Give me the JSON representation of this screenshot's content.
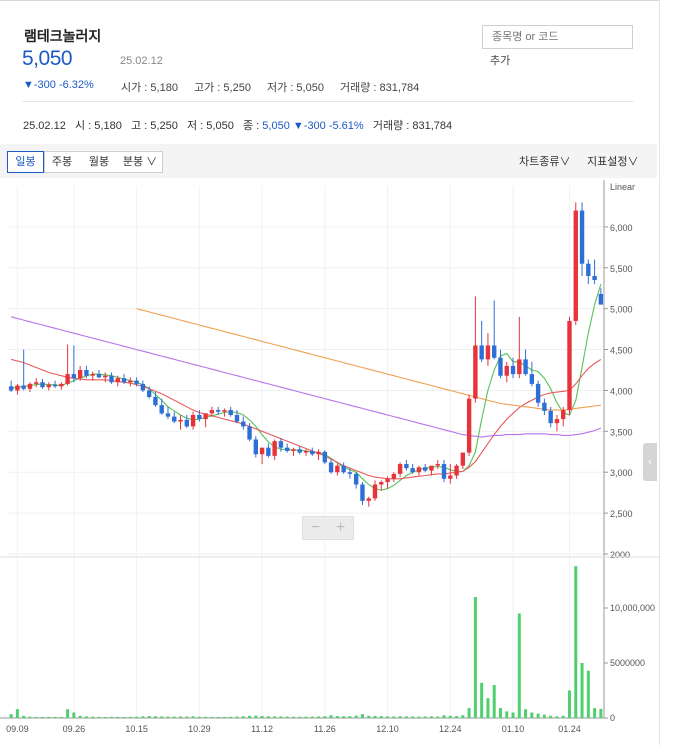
{
  "stock": {
    "name": "램테크놀러지",
    "price": "5,050",
    "date": "25.02.12",
    "change": "▼-300 -6.32%",
    "stats": [
      {
        "label": "시가 : ",
        "value": "5,180"
      },
      {
        "label": "고가 : ",
        "value": "5,250"
      },
      {
        "label": "저가 : ",
        "value": "5,050"
      },
      {
        "label": "거래량 : ",
        "value": "831,784"
      }
    ]
  },
  "search": {
    "placeholder": "종목명 or 코드",
    "add_label": "추가"
  },
  "info": {
    "date": "25.02.12",
    "open": "시 : 5,180",
    "high": "고 : 5,250",
    "low": "저 : 5,050",
    "close_label": "종 : ",
    "close": "5,050",
    "change": "▼-300 -5.61%",
    "volume": "거래량 : 831,784"
  },
  "tabs": {
    "daily": "일봉",
    "weekly": "주봉",
    "monthly": "월봉",
    "minute": "분봉 ∨"
  },
  "menus": {
    "chart_type": "차트종류∨",
    "indicator": "지표설정∨"
  },
  "zoom": {
    "minus": "−",
    "plus": "+"
  },
  "side_tab": "‹",
  "colors": {
    "up": "#e8333a",
    "down": "#2d6fd6",
    "ma5": "#58c15a",
    "ma20": "#e85a5a",
    "ma60": "#b774e8",
    "ma120": "#f0a050",
    "volume": "#4fcf6e"
  },
  "chart_data": {
    "type": "candlestick",
    "scale_label": "Linear",
    "y_ticks": [
      2000,
      2500,
      3000,
      3500,
      4000,
      4500,
      5000,
      5500,
      6000
    ],
    "y_tick_labels": [
      "2000",
      "2,500",
      "3,000",
      "3,500",
      "4,000",
      "4,500",
      "5,000",
      "5,500",
      "6,000"
    ],
    "ylim": [
      2000,
      6500
    ],
    "volume_ticks": [
      0,
      5000000,
      10000000
    ],
    "volume_tick_labels": [
      "0",
      "5000000",
      "10,000,000"
    ],
    "volume_ylim": [
      0,
      14000000
    ],
    "x_tick_labels": [
      {
        "index": 1,
        "label": "09.09"
      },
      {
        "index": 10,
        "label": "09.26"
      },
      {
        "index": 20,
        "label": "10.15"
      },
      {
        "index": 30,
        "label": "10.29"
      },
      {
        "index": 40,
        "label": "11.12"
      },
      {
        "index": 50,
        "label": "11.26"
      },
      {
        "index": 60,
        "label": "12.10"
      },
      {
        "index": 70,
        "label": "12.24"
      },
      {
        "index": 80,
        "label": "01.10"
      },
      {
        "index": 89,
        "label": "01.24"
      }
    ],
    "candles": [
      [
        4050,
        4120,
        3980,
        4000
      ],
      [
        4000,
        4080,
        3950,
        4060
      ],
      [
        4060,
        4500,
        4000,
        4020
      ],
      [
        4020,
        4100,
        3980,
        4080
      ],
      [
        4080,
        4150,
        4040,
        4100
      ],
      [
        4100,
        4140,
        4020,
        4040
      ],
      [
        4040,
        4100,
        4000,
        4070
      ],
      [
        4070,
        4120,
        4030,
        4050
      ],
      [
        4050,
        4100,
        4010,
        4080
      ],
      [
        4080,
        4560,
        4060,
        4200
      ],
      [
        4200,
        4550,
        4100,
        4150
      ],
      [
        4150,
        4300,
        4120,
        4250
      ],
      [
        4250,
        4300,
        4150,
        4180
      ],
      [
        4180,
        4230,
        4120,
        4200
      ],
      [
        4200,
        4250,
        4150,
        4160
      ],
      [
        4160,
        4220,
        4100,
        4180
      ],
      [
        4180,
        4220,
        4080,
        4100
      ],
      [
        4100,
        4180,
        4050,
        4150
      ],
      [
        4150,
        4200,
        4080,
        4100
      ],
      [
        4100,
        4160,
        4050,
        4120
      ],
      [
        4120,
        4160,
        4050,
        4080
      ],
      [
        4080,
        4120,
        3980,
        4000
      ],
      [
        4000,
        4050,
        3900,
        3920
      ],
      [
        3920,
        3980,
        3800,
        3820
      ],
      [
        3820,
        3900,
        3700,
        3720
      ],
      [
        3720,
        3800,
        3650,
        3680
      ],
      [
        3680,
        3740,
        3600,
        3620
      ],
      [
        3620,
        3700,
        3520,
        3640
      ],
      [
        3640,
        3700,
        3540,
        3560
      ],
      [
        3560,
        3740,
        3520,
        3700
      ],
      [
        3700,
        3760,
        3620,
        3650
      ],
      [
        3650,
        3720,
        3550,
        3720
      ],
      [
        3720,
        3800,
        3680,
        3760
      ],
      [
        3760,
        3800,
        3700,
        3740
      ],
      [
        3740,
        3780,
        3680,
        3760
      ],
      [
        3760,
        3800,
        3680,
        3700
      ],
      [
        3700,
        3760,
        3600,
        3620
      ],
      [
        3620,
        3680,
        3520,
        3560
      ],
      [
        3560,
        3600,
        3380,
        3400
      ],
      [
        3400,
        3440,
        3180,
        3220
      ],
      [
        3220,
        3300,
        3100,
        3300
      ],
      [
        3300,
        3350,
        3180,
        3200
      ],
      [
        3200,
        3400,
        3150,
        3380
      ],
      [
        3380,
        3420,
        3250,
        3300
      ],
      [
        3300,
        3350,
        3240,
        3260
      ],
      [
        3260,
        3300,
        3200,
        3280
      ],
      [
        3280,
        3320,
        3220,
        3240
      ],
      [
        3240,
        3280,
        3200,
        3260
      ],
      [
        3260,
        3300,
        3200,
        3220
      ],
      [
        3220,
        3280,
        3150,
        3250
      ],
      [
        3250,
        3270,
        3100,
        3120
      ],
      [
        3120,
        3160,
        2980,
        3000
      ],
      [
        3000,
        3100,
        2960,
        3080
      ],
      [
        3080,
        3120,
        2980,
        3000
      ],
      [
        3000,
        3050,
        2920,
        2980
      ],
      [
        2980,
        3000,
        2800,
        2850
      ],
      [
        2850,
        2880,
        2600,
        2650
      ],
      [
        2650,
        2700,
        2580,
        2680
      ],
      [
        2680,
        2900,
        2650,
        2850
      ],
      [
        2850,
        2900,
        2780,
        2880
      ],
      [
        2880,
        2950,
        2800,
        2920
      ],
      [
        2920,
        3000,
        2880,
        2980
      ],
      [
        2980,
        3120,
        2940,
        3100
      ],
      [
        3100,
        3150,
        3020,
        3050
      ],
      [
        3050,
        3100,
        2980,
        3000
      ],
      [
        3000,
        3080,
        2960,
        3060
      ],
      [
        3060,
        3100,
        3000,
        3020
      ],
      [
        3020,
        3060,
        2960,
        3080
      ],
      [
        3080,
        3150,
        3040,
        3100
      ],
      [
        3100,
        3150,
        2880,
        2920
      ],
      [
        2920,
        3100,
        2860,
        2960
      ],
      [
        2960,
        3100,
        2920,
        3080
      ],
      [
        3080,
        3200,
        3040,
        3240
      ],
      [
        3240,
        3950,
        3200,
        3900
      ],
      [
        3900,
        5150,
        3850,
        4550
      ],
      [
        4550,
        4850,
        4350,
        4380
      ],
      [
        4380,
        4700,
        4300,
        4550
      ],
      [
        4550,
        5100,
        4380,
        4400
      ],
      [
        4400,
        4500,
        4150,
        4180
      ],
      [
        4180,
        4350,
        4100,
        4300
      ],
      [
        4300,
        4400,
        4150,
        4200
      ],
      [
        4200,
        4900,
        4150,
        4380
      ],
      [
        4380,
        4500,
        4180,
        4200
      ],
      [
        4200,
        4350,
        4050,
        4080
      ],
      [
        4080,
        4120,
        3800,
        3850
      ],
      [
        3850,
        3900,
        3700,
        3750
      ],
      [
        3750,
        3800,
        3550,
        3600
      ],
      [
        3600,
        3700,
        3500,
        3650
      ],
      [
        3650,
        3800,
        3560,
        3760
      ],
      [
        3760,
        4900,
        3700,
        4850
      ],
      [
        4850,
        6300,
        4800,
        6200
      ],
      [
        6200,
        6300,
        5400,
        5550
      ],
      [
        5550,
        5600,
        5300,
        5400
      ],
      [
        5400,
        5600,
        5300,
        5350
      ],
      [
        5180,
        5250,
        5050,
        5050
      ]
    ],
    "volumes": [
      350000,
      800000,
      200000,
      120000,
      100000,
      90000,
      110000,
      100000,
      95000,
      800000,
      500000,
      200000,
      150000,
      120000,
      100000,
      90000,
      110000,
      100000,
      90000,
      100000,
      120000,
      150000,
      180000,
      160000,
      140000,
      130000,
      120000,
      140000,
      130000,
      160000,
      120000,
      110000,
      100000,
      90000,
      100000,
      110000,
      130000,
      160000,
      200000,
      220000,
      180000,
      160000,
      150000,
      140000,
      130000,
      120000,
      110000,
      120000,
      130000,
      140000,
      160000,
      250000,
      180000,
      160000,
      170000,
      220000,
      350000,
      200000,
      180000,
      170000,
      150000,
      140000,
      160000,
      150000,
      140000,
      130000,
      140000,
      150000,
      130000,
      250000,
      200000,
      180000,
      250000,
      900000,
      11000000,
      3200000,
      1800000,
      3000000,
      900000,
      600000,
      500000,
      9500000,
      800000,
      500000,
      400000,
      300000,
      200000,
      150000,
      200000,
      2500000,
      13800000,
      5000000,
      4300000,
      900000,
      830000
    ],
    "ma_lines": [
      {
        "key": "ma5",
        "values": [
          4030,
          4040,
          4050,
          4060,
          4070,
          4080,
          4070,
          4070,
          4060,
          4090,
          4120,
          4150,
          4180,
          4200,
          4200,
          4190,
          4180,
          4160,
          4140,
          4120,
          4100,
          4070,
          4020,
          3950,
          3880,
          3800,
          3750,
          3700,
          3660,
          3640,
          3650,
          3670,
          3690,
          3710,
          3730,
          3740,
          3730,
          3700,
          3640,
          3560,
          3460,
          3370,
          3310,
          3280,
          3280,
          3270,
          3270,
          3260,
          3250,
          3240,
          3220,
          3170,
          3110,
          3060,
          3030,
          3000,
          2920,
          2850,
          2800,
          2780,
          2800,
          2840,
          2900,
          2960,
          3000,
          3030,
          3050,
          3060,
          3070,
          3060,
          3030,
          3010,
          3010,
          3080,
          3250,
          3650,
          4000,
          4250,
          4420,
          4450,
          4350,
          4350,
          4300,
          4250,
          4230,
          4150,
          4020,
          3850,
          3730,
          3700,
          3880,
          4280,
          4700,
          5050,
          5300
        ]
      },
      {
        "key": "ma20",
        "values": [
          4380,
          4360,
          4340,
          4310,
          4280,
          4250,
          4220,
          4200,
          4180,
          4160,
          4150,
          4140,
          4130,
          4130,
          4130,
          4130,
          4120,
          4110,
          4100,
          4090,
          4070,
          4050,
          4020,
          3990,
          3960,
          3920,
          3880,
          3840,
          3800,
          3760,
          3730,
          3710,
          3690,
          3670,
          3650,
          3630,
          3610,
          3590,
          3560,
          3530,
          3500,
          3470,
          3440,
          3410,
          3380,
          3350,
          3320,
          3290,
          3260,
          3230,
          3200,
          3160,
          3120,
          3080,
          3050,
          3020,
          2990,
          2960,
          2940,
          2930,
          2920,
          2920,
          2920,
          2930,
          2940,
          2950,
          2960,
          2970,
          2980,
          2980,
          2990,
          3000,
          3010,
          3060,
          3130,
          3240,
          3350,
          3460,
          3560,
          3650,
          3720,
          3790,
          3840,
          3880,
          3920,
          3950,
          3970,
          3980,
          3990,
          4000,
          4080,
          4180,
          4270,
          4330,
          4380
        ]
      },
      {
        "key": "ma60",
        "values": [
          4900,
          4880,
          4860,
          4840,
          4820,
          4800,
          4780,
          4760,
          4740,
          4720,
          4700,
          4680,
          4660,
          4640,
          4620,
          4600,
          4580,
          4560,
          4540,
          4520,
          4500,
          4480,
          4460,
          4440,
          4420,
          4400,
          4380,
          4360,
          4340,
          4320,
          4300,
          4280,
          4260,
          4240,
          4220,
          4200,
          4180,
          4160,
          4140,
          4120,
          4100,
          4080,
          4060,
          4040,
          4020,
          4000,
          3980,
          3960,
          3940,
          3920,
          3900,
          3880,
          3860,
          3840,
          3820,
          3800,
          3780,
          3760,
          3740,
          3720,
          3700,
          3680,
          3660,
          3640,
          3620,
          3600,
          3580,
          3560,
          3540,
          3520,
          3500,
          3480,
          3460,
          3450,
          3440,
          3430,
          3440,
          3450,
          3450,
          3460,
          3460,
          3460,
          3470,
          3470,
          3470,
          3470,
          3460,
          3460,
          3450,
          3450,
          3460,
          3470,
          3490,
          3510,
          3540
        ]
      },
      {
        "key": "ma120",
        "values": [
          null,
          null,
          null,
          null,
          null,
          null,
          null,
          null,
          null,
          null,
          null,
          null,
          null,
          null,
          null,
          null,
          null,
          null,
          null,
          null,
          5000,
          4980,
          4960,
          4940,
          4920,
          4900,
          4880,
          4860,
          4840,
          4820,
          4800,
          4780,
          4760,
          4740,
          4720,
          4700,
          4680,
          4660,
          4640,
          4620,
          4600,
          4580,
          4560,
          4540,
          4520,
          4500,
          4480,
          4460,
          4440,
          4420,
          4400,
          4380,
          4360,
          4340,
          4320,
          4300,
          4280,
          4260,
          4240,
          4220,
          4200,
          4180,
          4160,
          4140,
          4120,
          4100,
          4080,
          4060,
          4040,
          4020,
          4000,
          3980,
          3960,
          3940,
          3920,
          3900,
          3880,
          3860,
          3840,
          3830,
          3820,
          3810,
          3800,
          3790,
          3780,
          3770,
          3760,
          3760,
          3760,
          3770,
          3780,
          3790,
          3800,
          3810,
          3820
        ]
      }
    ]
  }
}
